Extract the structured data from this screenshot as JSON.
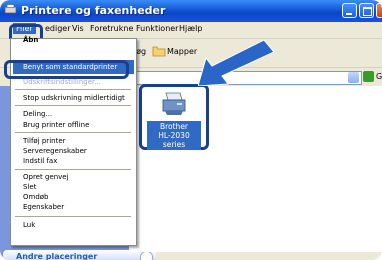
{
  "window": {
    "title": "Printere og faxenheder"
  },
  "menubar": {
    "items": [
      "Filer",
      "Rediger",
      "Vis",
      "Foretrukne",
      "Funktioner",
      "Hjælp"
    ],
    "visible_labels": [
      "Filer",
      "ediger",
      "Vis",
      "Foretrukne",
      "Funktioner",
      "Hjælp"
    ]
  },
  "toolbar": {
    "search_label": "Søg",
    "folders_label": "Mapper"
  },
  "addressbar": {
    "go_label": "G"
  },
  "file_menu": {
    "partial_top": "Åbn",
    "items": [
      "Benyt som standardprinter",
      "Udskriftsindstillinger...",
      "Stop udskrivning midlertidigt",
      "Deling...",
      "Brug printer offline",
      "Tilføj printer",
      "Serveregenskaber",
      "Indstil fax",
      "Opret genvej",
      "Slet",
      "Omdøb",
      "Egenskaber",
      "Luk"
    ]
  },
  "printer": {
    "label_line1": "Brother",
    "label_line2": "HL-2030 series"
  },
  "left_panel": {
    "header": "Andre placeringer"
  },
  "colors": {
    "highlight": "#316ac5",
    "callout": "#1b3f8f",
    "arrow": "#2a66c8",
    "titlebar": "#0a47c8"
  }
}
